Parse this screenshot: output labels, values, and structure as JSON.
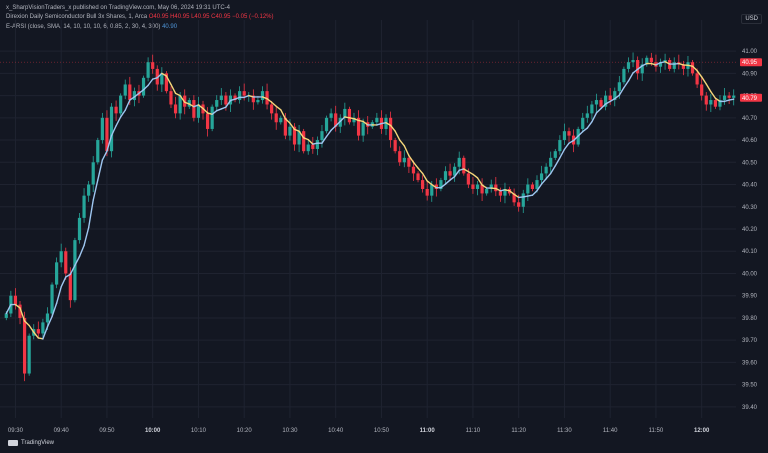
{
  "header": {
    "publisher": "x_SharpVisionTraders_x published on TradingView.com, May 06, 2024 19:31 UTC-4",
    "symbol_line": "Direxion Daily Semiconductor Bull 3x Shares, 1, Arca",
    "ohlc": "O40.95  H40.95  L40.95  C40.95  −0.05 (−0.12%)",
    "indicator_line": "E-ARSI (close, SMA, 14, 10, 10, 10, 6, 0.85, 2, 30, 4, 300)",
    "indicator_value": "40.90",
    "currency": "USD"
  },
  "footer": {
    "brand": "TradingView"
  },
  "colors": {
    "up": "#26a69a",
    "down": "#f23645",
    "bg": "#131722",
    "grid": "#1f2330",
    "line_blue": "#9ec6f0",
    "line_yellow": "#f5d77a",
    "label_red": "#f23645"
  },
  "chart_data": {
    "type": "candlestick",
    "ylim": [
      39.35,
      41.05
    ],
    "y_ticks": [
      39.4,
      39.5,
      39.6,
      39.7,
      39.8,
      39.9,
      40.0,
      40.1,
      40.2,
      40.3,
      40.4,
      40.5,
      40.6,
      40.7,
      40.8,
      40.9,
      41.0
    ],
    "y_tick_labels": [
      "39.40",
      "39.50",
      "39.60",
      "39.70",
      "39.80",
      "39.90",
      "40.00",
      "40.10",
      "40.20",
      "40.30",
      "40.40",
      "40.50",
      "40.60",
      "40.70",
      "40.80",
      "40.90",
      "41.00"
    ],
    "x_ticks": [
      {
        "label": "09:30",
        "bold": false,
        "index": 2
      },
      {
        "label": "09:40",
        "bold": false,
        "index": 12
      },
      {
        "label": "09:50",
        "bold": false,
        "index": 22
      },
      {
        "label": "10:00",
        "bold": true,
        "index": 32
      },
      {
        "label": "10:10",
        "bold": false,
        "index": 42
      },
      {
        "label": "10:20",
        "bold": false,
        "index": 52
      },
      {
        "label": "10:30",
        "bold": false,
        "index": 62
      },
      {
        "label": "10:40",
        "bold": false,
        "index": 72
      },
      {
        "label": "10:50",
        "bold": false,
        "index": 82
      },
      {
        "label": "11:00",
        "bold": true,
        "index": 92
      },
      {
        "label": "11:10",
        "bold": false,
        "index": 102
      },
      {
        "label": "11:20",
        "bold": false,
        "index": 112
      },
      {
        "label": "11:30",
        "bold": false,
        "index": 122
      },
      {
        "label": "11:40",
        "bold": false,
        "index": 132
      },
      {
        "label": "11:50",
        "bold": false,
        "index": 142
      },
      {
        "label": "12:00",
        "bold": true,
        "index": 152
      }
    ],
    "close": [
      39.82,
      39.9,
      39.86,
      39.8,
      39.55,
      39.72,
      39.75,
      39.73,
      39.78,
      39.82,
      39.95,
      40.05,
      40.1,
      40.0,
      39.88,
      40.15,
      40.25,
      40.35,
      40.4,
      40.5,
      40.6,
      40.7,
      40.55,
      40.75,
      40.72,
      40.8,
      40.85,
      40.78,
      40.82,
      40.8,
      40.88,
      40.95,
      40.92,
      40.85,
      40.9,
      40.82,
      40.76,
      40.72,
      40.8,
      40.75,
      40.78,
      40.7,
      40.76,
      40.72,
      40.65,
      40.75,
      40.78,
      40.8,
      40.76,
      40.8,
      40.78,
      40.82,
      40.8,
      40.8,
      40.77,
      40.78,
      40.82,
      40.76,
      40.72,
      40.68,
      40.7,
      40.62,
      40.66,
      40.58,
      40.64,
      40.55,
      40.58,
      40.56,
      40.6,
      40.64,
      40.7,
      40.72,
      40.66,
      40.7,
      40.74,
      40.68,
      40.7,
      40.62,
      40.68,
      40.66,
      40.68,
      40.7,
      40.65,
      40.7,
      40.6,
      40.55,
      40.5,
      40.52,
      40.48,
      40.45,
      40.42,
      40.38,
      40.35,
      40.4,
      40.38,
      40.42,
      40.46,
      40.44,
      40.48,
      40.52,
      40.45,
      40.4,
      40.38,
      40.4,
      40.36,
      40.38,
      40.4,
      40.37,
      40.35,
      40.38,
      40.36,
      40.32,
      40.3,
      40.36,
      40.4,
      40.38,
      40.42,
      40.45,
      40.48,
      40.52,
      40.55,
      40.6,
      40.64,
      40.62,
      40.58,
      40.65,
      40.7,
      40.72,
      40.76,
      40.78,
      40.75,
      40.8,
      40.78,
      40.82,
      40.86,
      40.92,
      40.95,
      40.96,
      40.9,
      40.94,
      40.97,
      40.95,
      40.93,
      40.95,
      40.96,
      40.92,
      40.95,
      40.94,
      40.92,
      40.95,
      40.9,
      40.85,
      40.8,
      40.76,
      40.78,
      40.75,
      40.78,
      40.8,
      40.79,
      40.8
    ]
  },
  "price_labels": {
    "upper": "40.95",
    "lower": "40.79"
  }
}
